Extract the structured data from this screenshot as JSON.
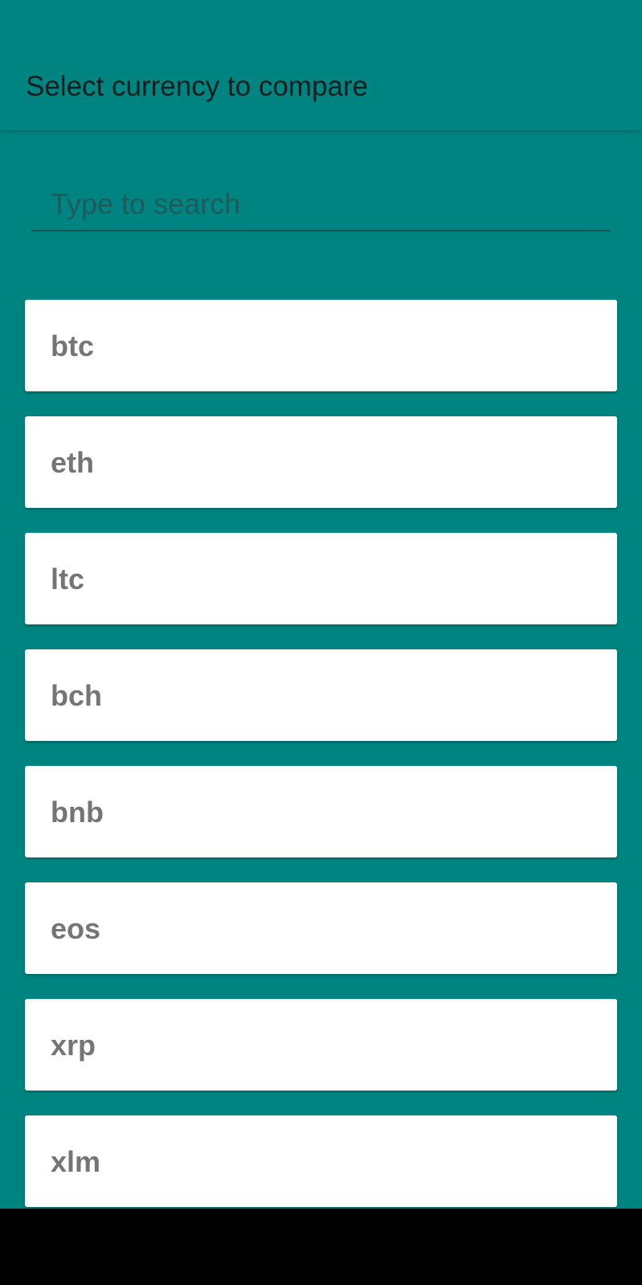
{
  "app_bar": {
    "title": "Select currency to compare"
  },
  "search": {
    "placeholder": "Type to search",
    "value": ""
  },
  "currencies": [
    {
      "label": "btc"
    },
    {
      "label": "eth"
    },
    {
      "label": "ltc"
    },
    {
      "label": "bch"
    },
    {
      "label": "bnb"
    },
    {
      "label": "eos"
    },
    {
      "label": "xrp"
    },
    {
      "label": "xlm"
    }
  ],
  "colors": {
    "background": "#008481",
    "card": "#ffffff",
    "card_text": "#757575",
    "title_text": "#101e1e"
  }
}
